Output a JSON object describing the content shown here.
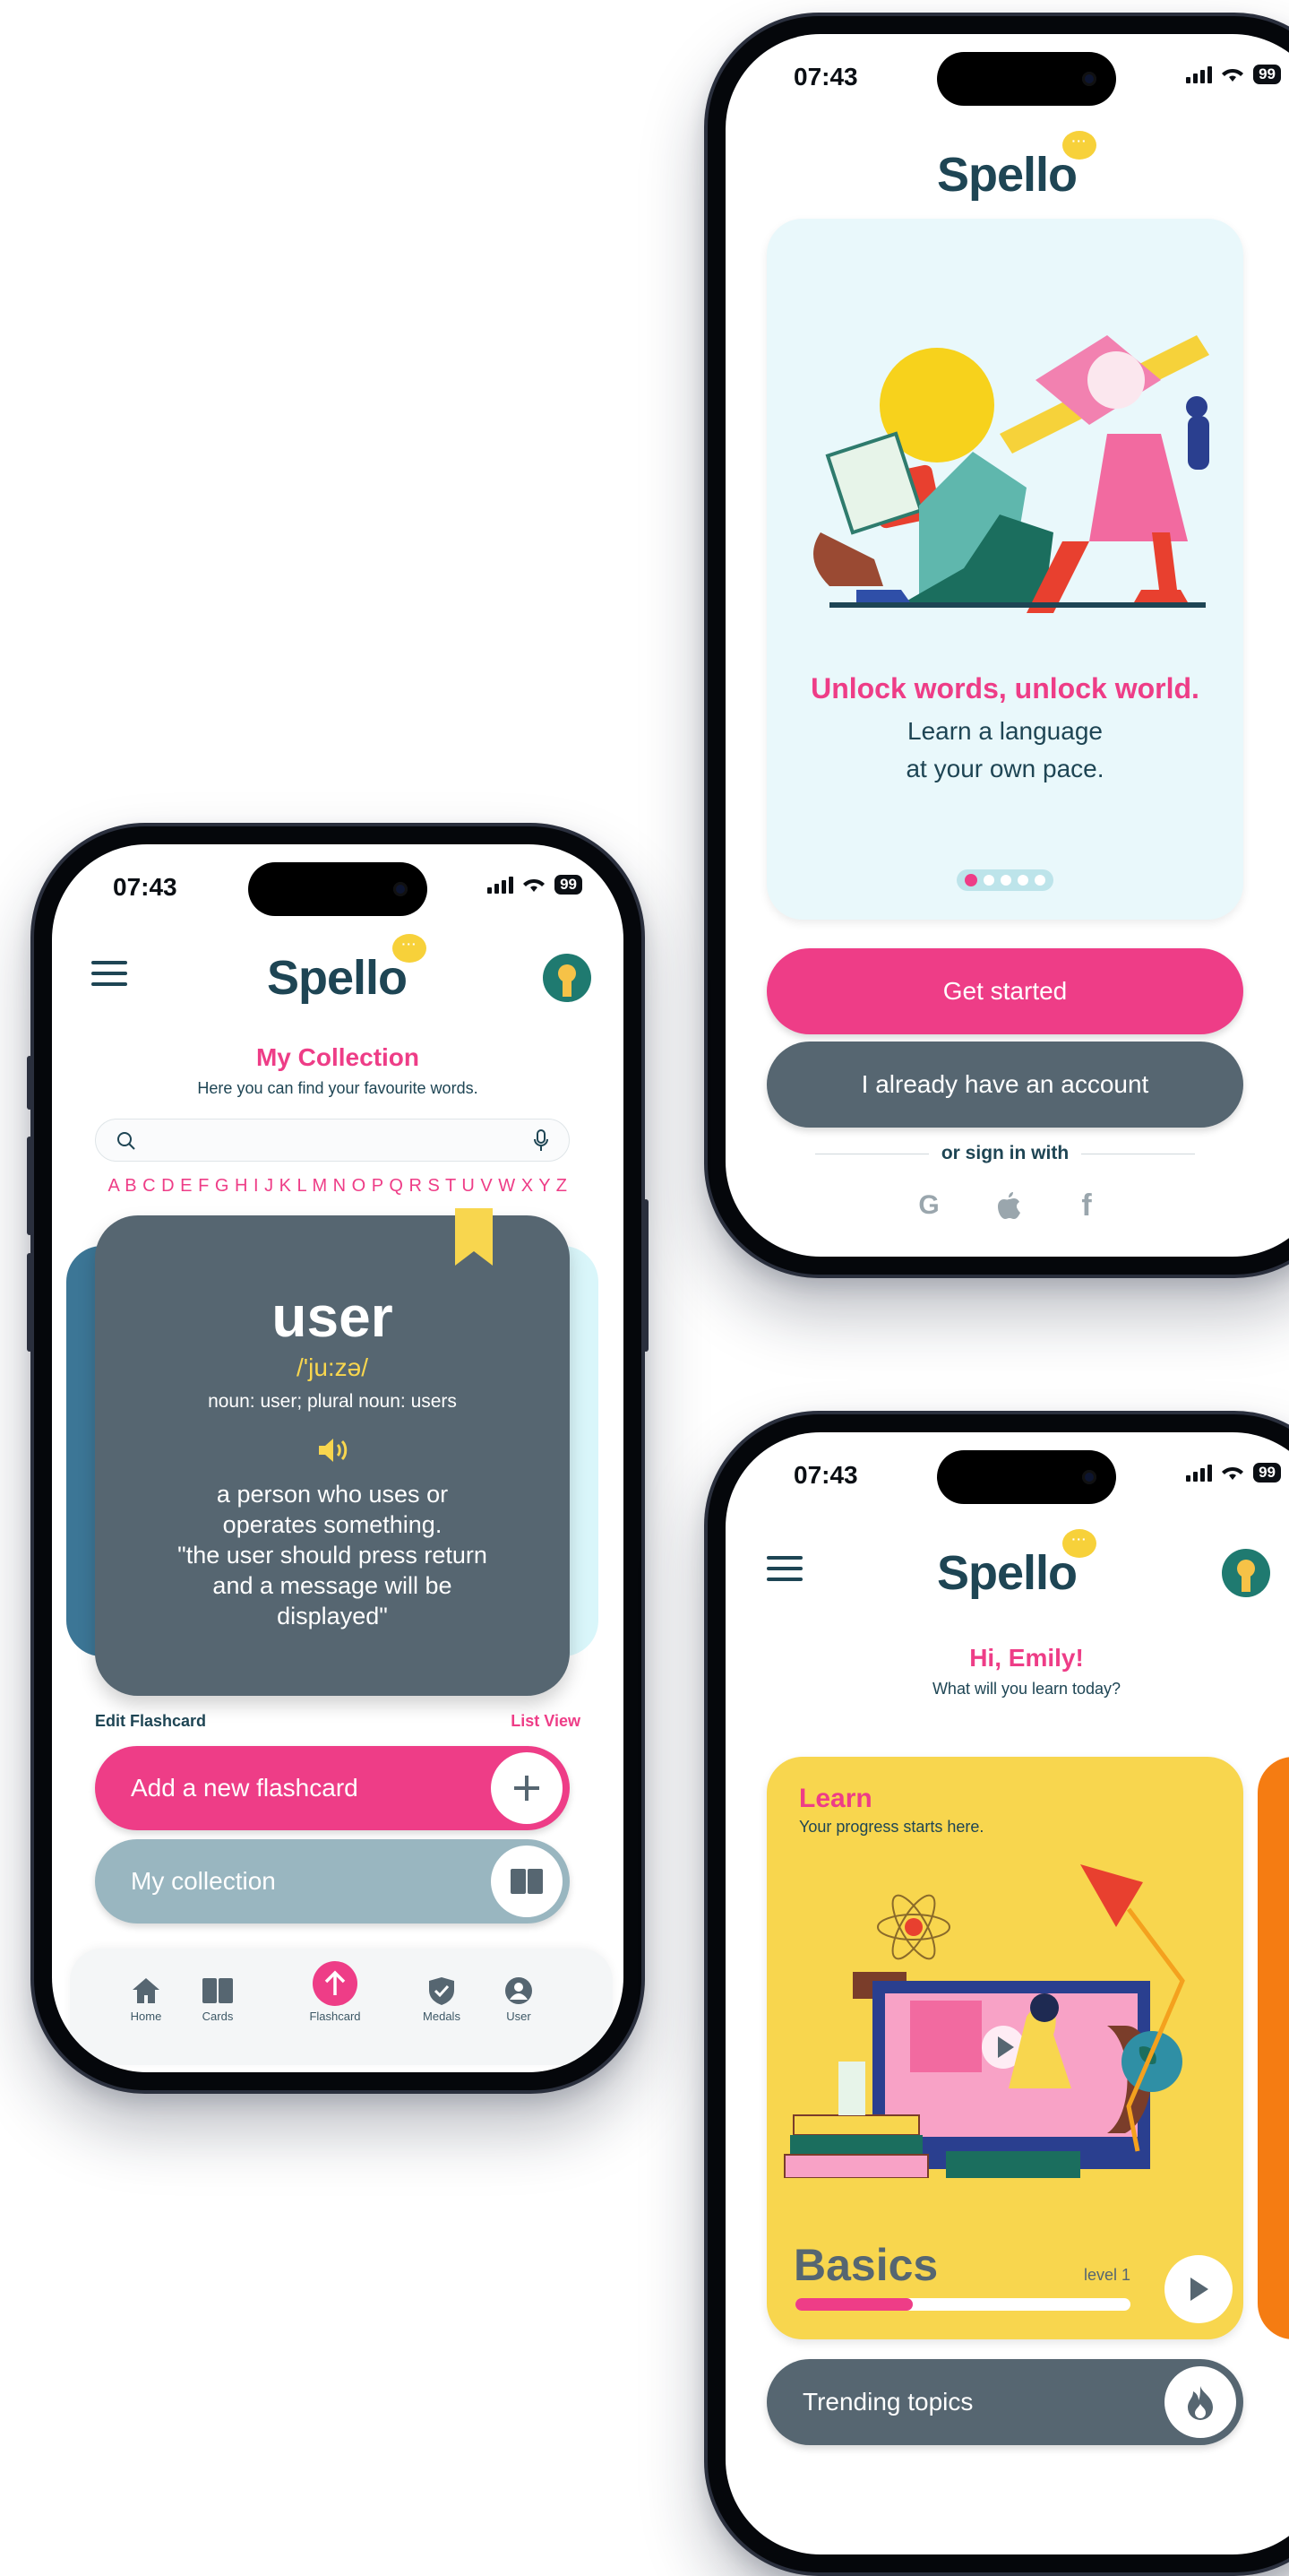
{
  "status": {
    "time": "07:43",
    "battery": "99"
  },
  "brand": {
    "name": "Spello",
    "bubble": "···"
  },
  "onboarding": {
    "headline": "Unlock words, unlock world.",
    "subline_1": "Learn a language",
    "subline_2": "at your own pace.",
    "primary_button": "Get started",
    "secondary_button": "I already have an account",
    "divider_text": "or sign in with",
    "social": [
      "G",
      "",
      "f"
    ],
    "pager_total": 5,
    "pager_active": 1
  },
  "collection": {
    "title": "My Collection",
    "subtitle": "Here you can find your favourite words.",
    "alphabet": "A B C D E F G H I J K L M N O P Q R S T U V W X Y Z",
    "card": {
      "word": "user",
      "phonetic": "/'ju:zə/",
      "grammar": "noun: user; plural noun: users",
      "def_1": "a person who uses or",
      "def_2": "operates something.",
      "def_3": "\"the user should press return",
      "def_4": "and a message will be",
      "def_5": "displayed\""
    },
    "edit_link": "Edit Flashcard",
    "list_link": "List View",
    "add_button": "Add a new flashcard",
    "collection_button": "My collection",
    "nav": [
      {
        "label": "Home"
      },
      {
        "label": "Cards"
      },
      {
        "label": "Flashcard"
      },
      {
        "label": "Medals"
      },
      {
        "label": "User"
      }
    ]
  },
  "home": {
    "greeting": "Hi, Emily!",
    "prompt": "What will you learn today?",
    "learn_title": "Learn",
    "learn_subtitle": "Your progress starts here.",
    "course_title": "Basics",
    "level": "level 1",
    "progress": 0.35,
    "trending": "Trending topics"
  },
  "colors": {
    "pink": "#ee3d87",
    "navy": "#1e4554",
    "slate": "#566671",
    "light_blue": "#e9f8fb",
    "yellow": "#f8d64e",
    "orange": "#f57c12"
  }
}
